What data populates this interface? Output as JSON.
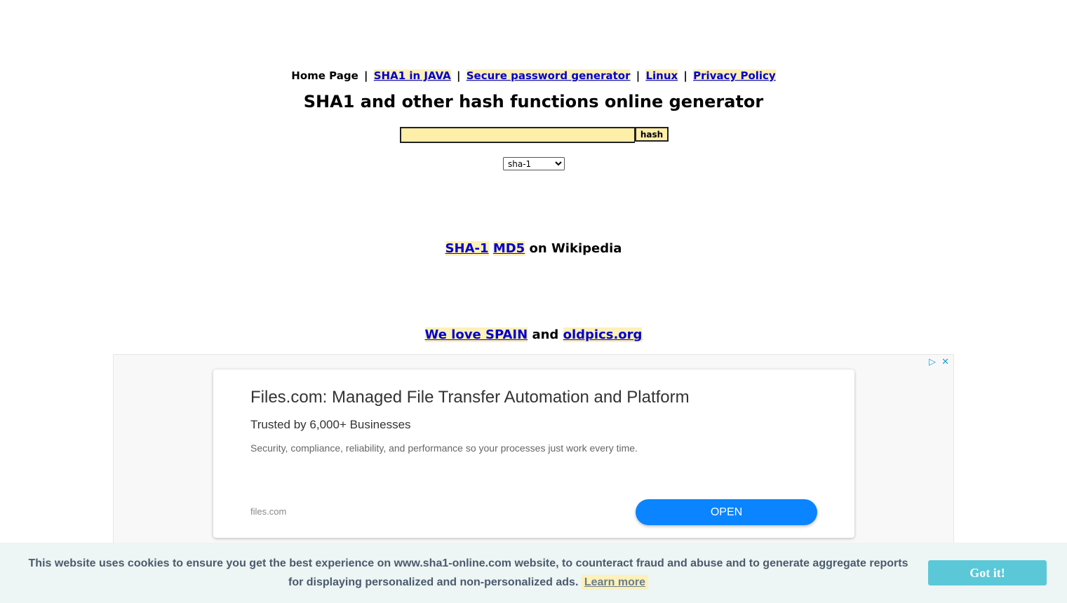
{
  "nav": {
    "home": "Home Page",
    "separator": "|",
    "links": [
      "SHA1 in JAVA",
      "Secure password generator",
      "Linux",
      "Privacy Policy"
    ]
  },
  "page_title": "SHA1 and other hash functions online generator",
  "hash_form": {
    "input_value": "",
    "button_label": "hash",
    "algorithm_selected": "sha-1"
  },
  "wiki": {
    "links": [
      "SHA-1",
      "MD5"
    ],
    "suffix": "on Wikipedia"
  },
  "promo": {
    "link1": "We love SPAIN",
    "and": "and",
    "link2": "oldpics.org"
  },
  "ad": {
    "icons": [
      "ad-choices-icon",
      "close-icon"
    ],
    "title": "Files.com: Managed File Transfer Automation and Platform",
    "subtitle": "Trusted by 6,000+ Businesses",
    "description": "Security, compliance, reliability, and performance so your processes just work every time.",
    "domain": "files.com",
    "cta": "OPEN"
  },
  "cookie": {
    "message": "This website uses cookies to ensure you get the best experience on www.sha1-online.com website, to counteract fraud and abuse and to generate aggregate reports for displaying personalized and non-personalized ads.",
    "learn_more": "Learn more",
    "accept": "Got it!"
  },
  "colors": {
    "link": "#0000cc",
    "highlight": "#fdf0b8",
    "input_bg": "#fdeea8",
    "ad_button": "#0a84ff",
    "cookie_button": "#5bc8d8",
    "cookie_bg": "#edf5f5"
  }
}
